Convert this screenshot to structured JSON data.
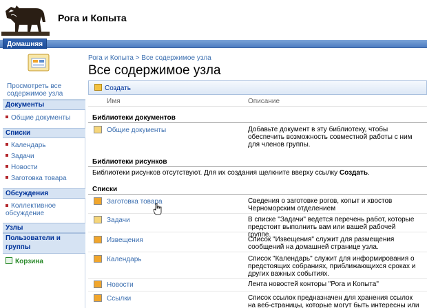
{
  "header": {
    "site_title": "Рога и Копыта"
  },
  "topnav": {
    "home_tab": "Домашняя"
  },
  "breadcrumb": {
    "site": "Рога и Копыта",
    "separator": ">",
    "current": "Все содержимое узла"
  },
  "page_title": "Все содержимое узла",
  "leftnav": {
    "view_all": "Просмотреть все содержимое узла",
    "documents": {
      "heading": "Документы",
      "items": [
        "Общие документы"
      ]
    },
    "lists": {
      "heading": "Списки",
      "items": [
        "Календарь",
        "Задачи",
        "Новости",
        "Заготовка товара"
      ]
    },
    "discussions": {
      "heading": "Обсуждения",
      "items": [
        "Коллективное обсуждение"
      ]
    },
    "sites": {
      "heading": "Узлы"
    },
    "people": {
      "heading": "Пользователи и группы"
    },
    "recycle_bin": "Корзина"
  },
  "toolbar": {
    "create_label": "Создать"
  },
  "columns": {
    "name": "Имя",
    "description": "Описание"
  },
  "sections": {
    "doc_libraries": {
      "heading": "Библиотеки документов",
      "items": [
        {
          "name": "Общие документы",
          "description": "Добавьте документ в эту библиотеку, чтобы обеспечить возможность совместной работы с ним для членов группы."
        }
      ]
    },
    "pic_libraries": {
      "heading": "Библиотеки рисунков",
      "empty_text": "Библиотеки рисунков отсутствуют. Для их создания щелкните вверху ссылку",
      "empty_link": "Создать",
      "empty_end": "."
    },
    "lists": {
      "heading": "Списки",
      "items": [
        {
          "name": "Заготовка товара",
          "description": "Сведения о заготовке рогов, копыт и хвостов Черноморским отделением"
        },
        {
          "name": "Задачи",
          "description": "В списке \"Задачи\" ведется перечень работ, которые предстоит выполнить вам или вашей рабочей группе."
        },
        {
          "name": "Извещения",
          "description": "Список \"Извещения\" служит для размещения сообщений на домашней странице узла."
        },
        {
          "name": "Календарь",
          "description": "Список \"Календарь\" служит для информирования о предстоящих собраниях, приближающихся сроках и других важных событиях."
        },
        {
          "name": "Новости",
          "description": "Лента новостей конторы \"Рога и Копыта\""
        },
        {
          "name": "Ссылки",
          "description": "Список ссылок предназначен для хранения ссылок на веб-страницы, которые могут быть интересны или"
        }
      ]
    }
  },
  "colors": {
    "link": "#3c6fb0",
    "nav_head_bg": "#d6e3f3",
    "tab_bg": "#1d4d98",
    "recycle": "#2b8a2b"
  }
}
